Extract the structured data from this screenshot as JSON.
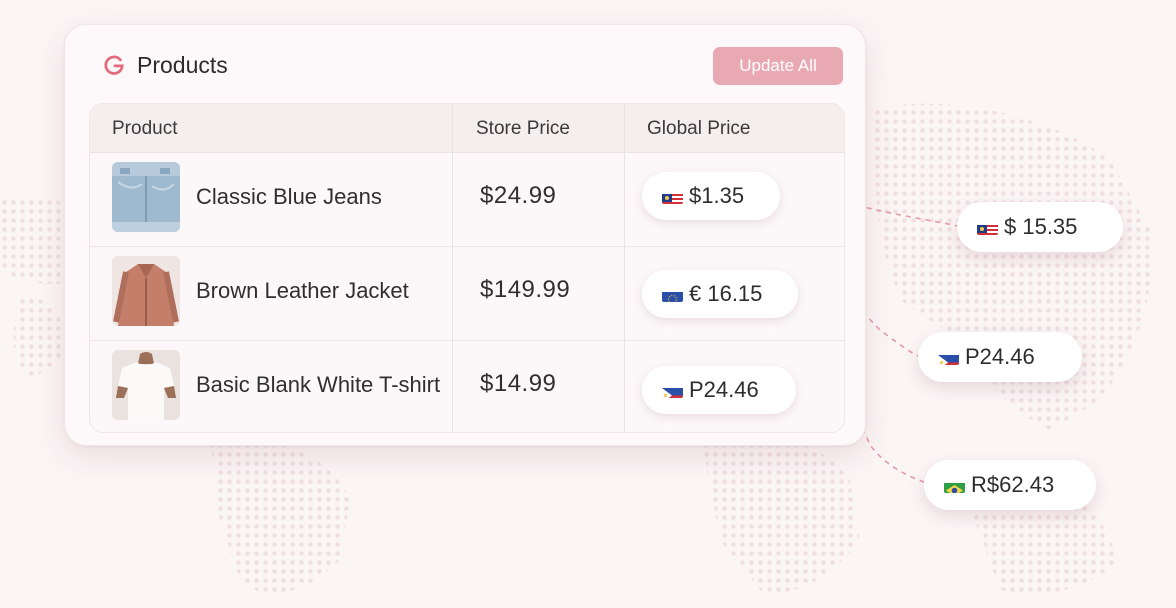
{
  "card": {
    "title": "Products",
    "update_button": "Update All"
  },
  "table": {
    "columns": [
      "Product",
      "Store Price",
      "Global Price"
    ],
    "rows": [
      {
        "product": "Classic Blue Jeans",
        "store_price": "$24.99",
        "global_price": "$1.35",
        "flag": "malaysia-flag-icon"
      },
      {
        "product": "Brown Leather Jacket",
        "store_price": "$149.99",
        "global_price": "€ 16.15",
        "flag": "eu-flag-icon"
      },
      {
        "product": "Basic Blank White T-shirt",
        "store_price": "$14.99",
        "global_price": "P24.46",
        "flag": "philippines-flag-icon"
      }
    ]
  },
  "floating_prices": [
    {
      "value": "$ 15.35",
      "flag": "malaysia-flag-icon"
    },
    {
      "value": "P24.46",
      "flag": "philippines-flag-icon"
    },
    {
      "value": "R$62.43",
      "flag": "brazil-flag-icon"
    }
  ],
  "colors": {
    "accent": "#e46b7b",
    "button": "#e9a9b2",
    "background": "#fbf5f6",
    "connector": "#e39aa6"
  }
}
